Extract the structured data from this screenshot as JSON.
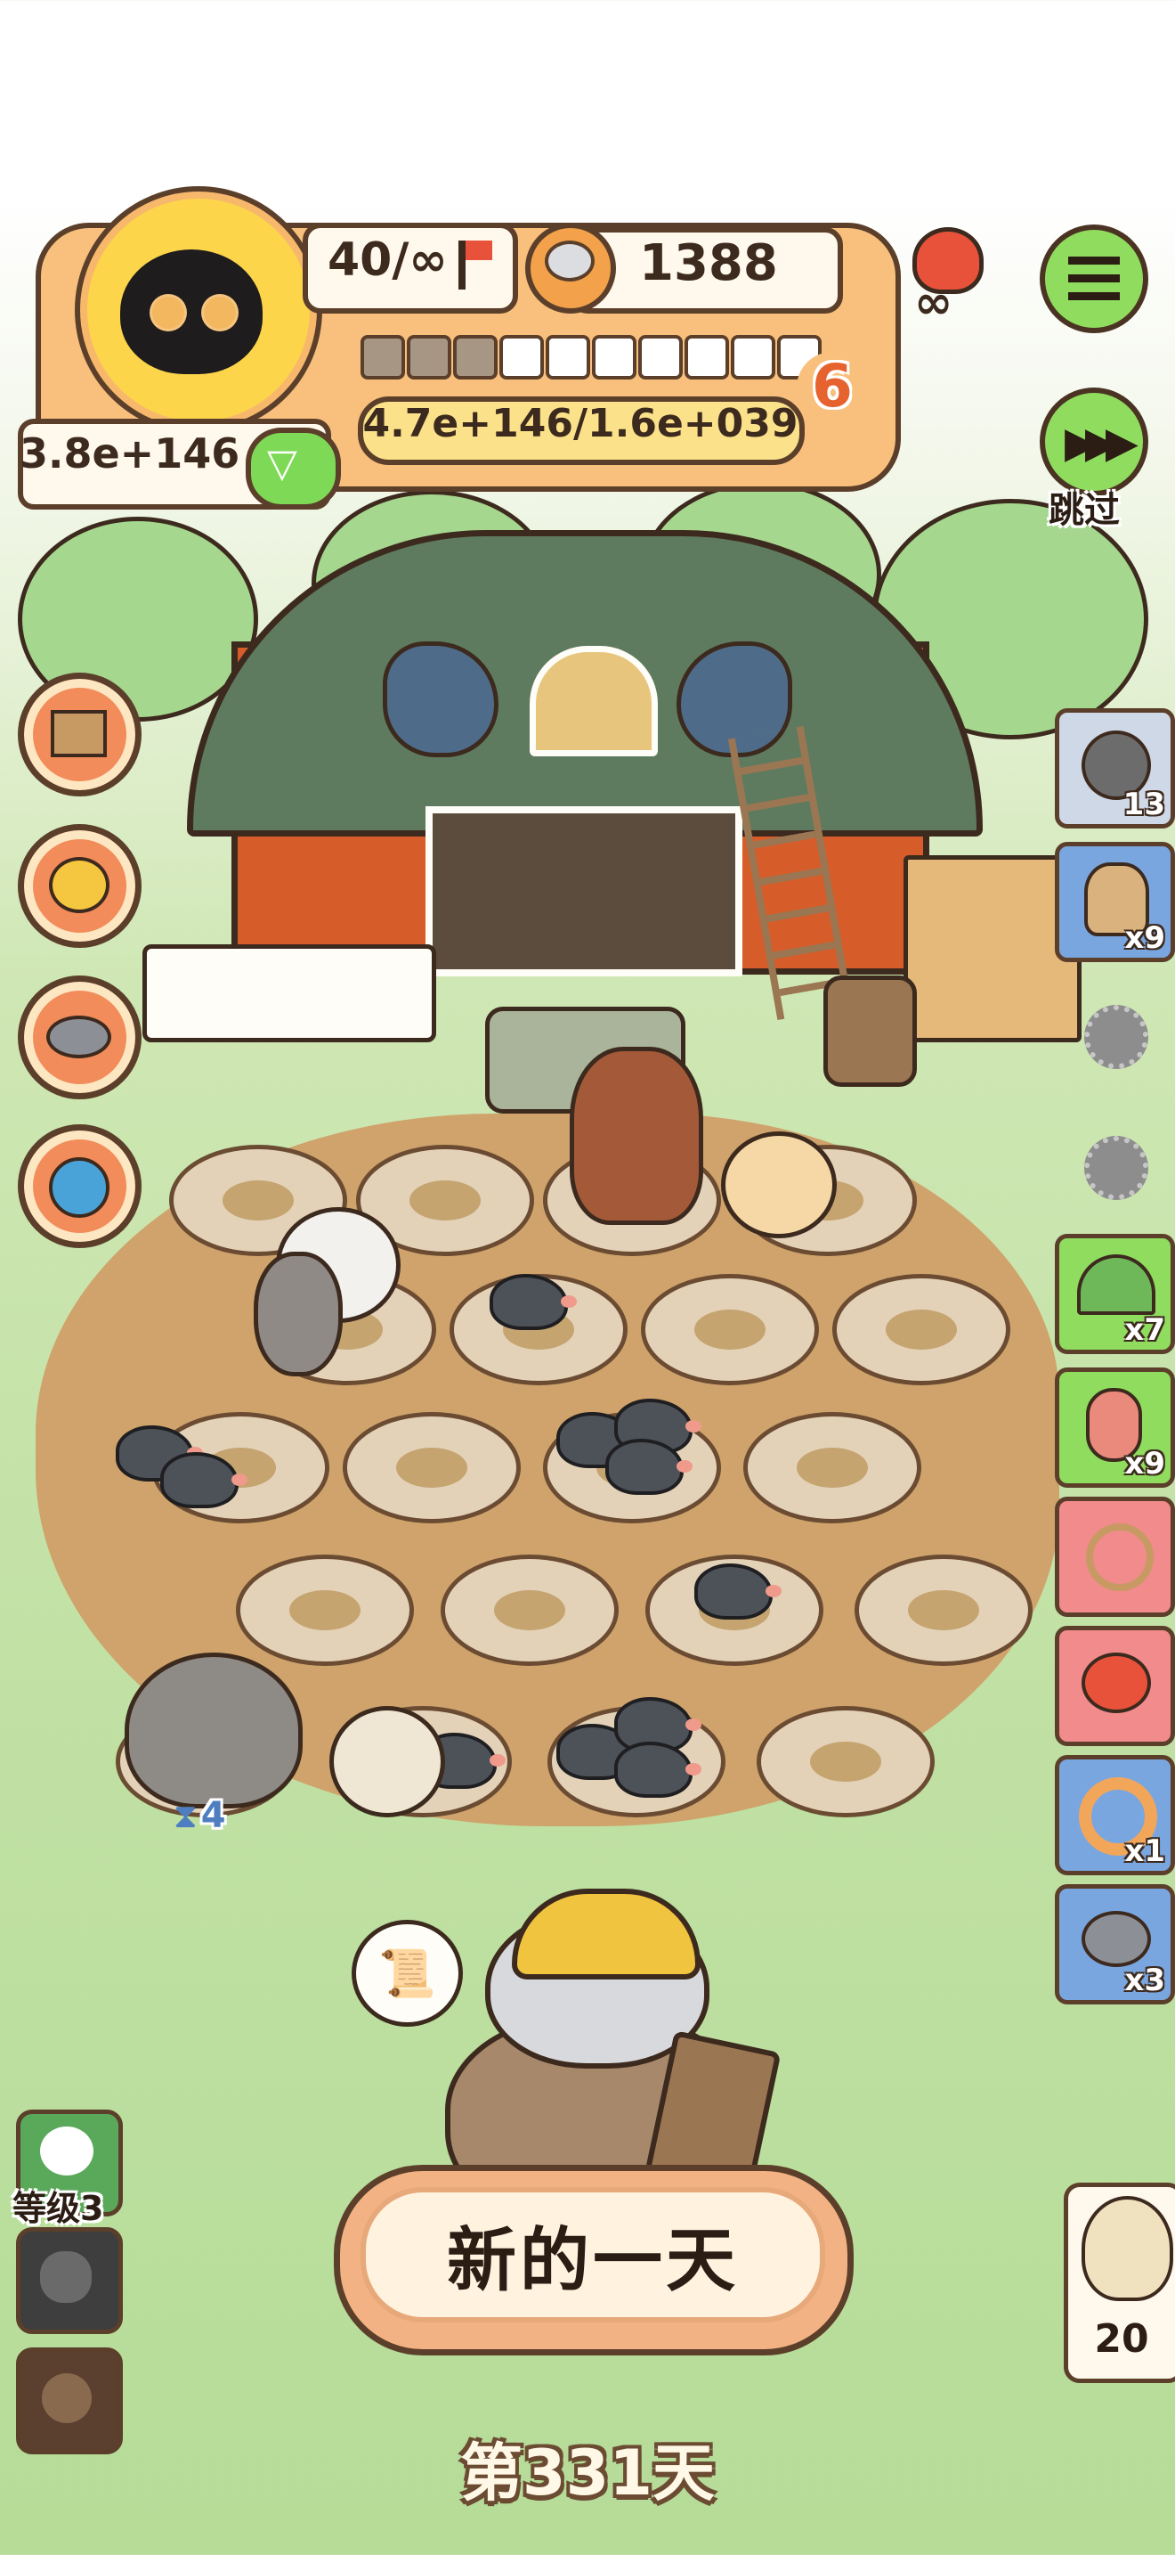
{
  "hud": {
    "stage_text": "40/∞",
    "coins": "1388",
    "level": "6",
    "exp_text": "4.7e+146/1.6e+039",
    "power": "3.8e+146",
    "progress_segments_filled": 3,
    "progress_segments_total": 10
  },
  "controls": {
    "skip_label": "跳过",
    "menu_icon": "list-icon",
    "skip_icon": "fast-forward-icon"
  },
  "right_items": [
    {
      "icon": "film-reel-icon",
      "count": "13",
      "color": "#cfd8e6"
    },
    {
      "icon": "grain-sack-icon",
      "count": "x9",
      "color": "#7aa6e0"
    },
    {
      "icon": "tent-icon",
      "count": "x7",
      "color": "#8fdc5e"
    },
    {
      "icon": "worm-icon",
      "count": "x9",
      "color": "#8fdc5e"
    },
    {
      "icon": "rope-icon",
      "count": "",
      "color": "#f28b8b"
    },
    {
      "icon": "crab-icon",
      "count": "",
      "color": "#f28b8b"
    },
    {
      "icon": "donut-icon",
      "count": "x1",
      "color": "#7aa6e0"
    },
    {
      "icon": "food-can-icon",
      "count": "x3",
      "color": "#7aa6e0"
    }
  ],
  "left_actions": [
    {
      "icon": "box-icon"
    },
    {
      "icon": "eggs-icon"
    },
    {
      "icon": "bowl-icon"
    },
    {
      "icon": "toy-icon"
    }
  ],
  "bottom_left": {
    "level_label": "等级3"
  },
  "timer_value": "4",
  "owl_count": "20",
  "new_day_button": "新的一天",
  "day_counter": "第331天",
  "colors": {
    "panel": "#f8c07c",
    "outline": "#5b3f2a",
    "green_button": "#8fdc5e",
    "barn_red": "#d65c2a",
    "field": "#cfa36b"
  }
}
